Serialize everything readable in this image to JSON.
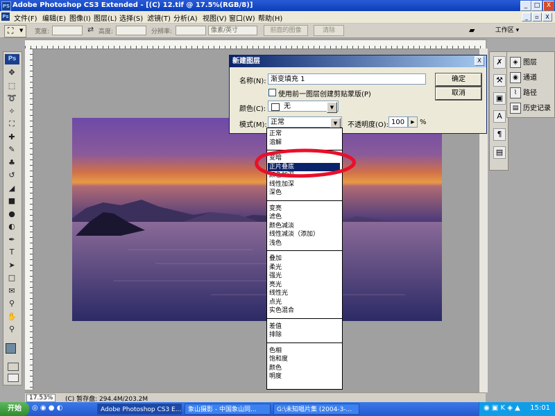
{
  "window": {
    "app_icon": "PS",
    "title": "Adobe Photoshop CS3 Extended - [(C) 12.tif @ 17.5%(RGB/8)]",
    "controls": {
      "minimize": "_",
      "maximize": "□",
      "close": "X"
    },
    "doc_controls": {
      "minimize": "_",
      "restore": "▫",
      "close": "X"
    }
  },
  "menu": {
    "icon": "Ps",
    "items": [
      "文件(F)",
      "编辑(E)",
      "图像(I)",
      "图层(L)",
      "选择(S)",
      "滤镜(T)",
      "分析(A)",
      "视图(V)",
      "窗口(W)",
      "帮助(H)"
    ]
  },
  "options": {
    "width_label": "宽度:",
    "height_label": "高度:",
    "res_label": "分辨率:",
    "unit": "像素/英寸",
    "front_image": "前面的图像",
    "clear": "清除",
    "workspace": "工作区 ▾"
  },
  "toolbox": {
    "logo": "Ps",
    "tools": [
      "move-icon",
      "marquee-icon",
      "lasso-icon",
      "magic-wand-icon",
      "crop-icon",
      "heal-icon",
      "brush-icon",
      "stamp-icon",
      "history-brush-icon",
      "eraser-icon",
      "gradient-icon",
      "blur-icon",
      "dodge-icon",
      "pen-icon",
      "type-icon",
      "path-select-icon",
      "shape-icon",
      "notes-icon",
      "eyedropper-icon",
      "hand-icon",
      "zoom-icon"
    ],
    "glyphs": [
      "✥",
      "⬚",
      "➰",
      "✧",
      "⛶",
      "✚",
      "✎",
      "♣",
      "↺",
      "◢",
      "■",
      "●",
      "◐",
      "✒",
      "T",
      "➤",
      "□",
      "✉",
      "⚲",
      "✋",
      "⚲"
    ]
  },
  "dialog": {
    "title": "新建图层",
    "close": "X",
    "name_label": "名称(N):",
    "name_value": "渐变填充 1",
    "clip_checkbox": "使用前一图层创建剪贴蒙版(P)",
    "color_label": "颜色(C):",
    "color_value": "无",
    "mode_label": "模式(M):",
    "mode_value": "正常",
    "opacity_label": "不透明度(O):",
    "opacity_value": "100",
    "opacity_unit": "%",
    "ok": "确定",
    "cancel": "取消"
  },
  "blend_modes": {
    "groups": [
      [
        "正常",
        "溶解"
      ],
      [
        "变暗",
        "正片叠底",
        "颜色加深",
        "线性加深",
        "深色"
      ],
      [
        "变亮",
        "滤色",
        "颜色减淡",
        "线性减淡（添加）",
        "浅色"
      ],
      [
        "叠加",
        "柔光",
        "强光",
        "亮光",
        "线性光",
        "点光",
        "实色混合"
      ],
      [
        "差值",
        "排除"
      ],
      [
        "色相",
        "饱和度",
        "颜色",
        "明度"
      ]
    ],
    "selected": "正片叠底"
  },
  "panels": {
    "items": [
      {
        "icon": "layers-icon",
        "glyph": "◈",
        "label": "图层"
      },
      {
        "icon": "channels-icon",
        "glyph": "◉",
        "label": "通道"
      },
      {
        "icon": "paths-icon",
        "glyph": "⌇",
        "label": "路径"
      },
      {
        "icon": "history-icon",
        "glyph": "▤",
        "label": "历史记录"
      }
    ],
    "dock_glyphs": [
      "✗",
      "⚒",
      "▣",
      "A",
      "¶",
      "▤"
    ]
  },
  "status": {
    "zoom": "17.53%",
    "info": "(C) 暂存盘: 294.4M/203.2M"
  },
  "taskbar": {
    "start": "开始",
    "tasks": [
      "Adobe Photoshop CS3 E...",
      "象山摄影 - 中国象山同...",
      "G:\\未知唱片集 (2004-3-..."
    ],
    "clock": "15:01"
  },
  "colors": {
    "highlight": "#0a246a",
    "annotation": "#e8102a",
    "dialog_bg": "#ece9d8"
  }
}
